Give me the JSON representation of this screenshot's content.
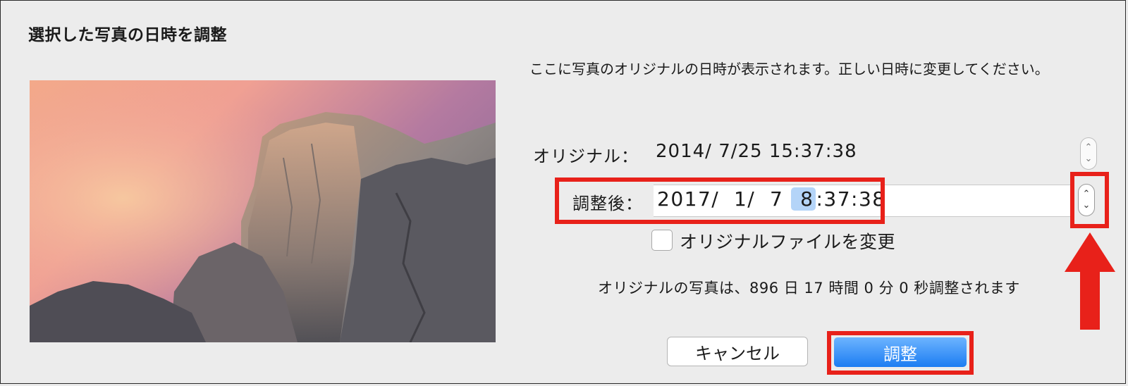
{
  "dialog": {
    "title": "選択した写真の日時を調整",
    "description": "ここに写真のオリジナルの日時が表示されます。正しい日時に変更してください。"
  },
  "original": {
    "label": "オリジナル：",
    "value": "2014/  7/25 15:37:38",
    "stepper_up": "⌃",
    "stepper_down": "⌄"
  },
  "adjusted": {
    "label": "調整後：",
    "value_before_hour": "2017/  1/  7 ",
    "value_hour": " 8",
    "value_after_hour": ":37:38",
    "stepper_up": "⌃",
    "stepper_down": "⌄"
  },
  "modify_original": {
    "label": "オリジナルファイルを変更",
    "checked": false
  },
  "info_text": "オリジナルの写真は、896 日 17 時間 0 分 0 秒調整されます",
  "buttons": {
    "cancel": "キャンセル",
    "adjust": "調整"
  },
  "colors": {
    "highlight_red": "#e8211a",
    "primary_button": "#1c7df2",
    "selection": "#b4d4f8"
  }
}
